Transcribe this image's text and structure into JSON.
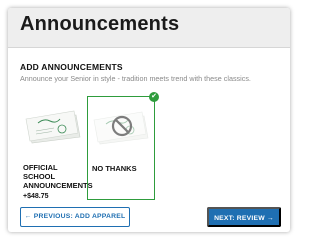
{
  "header": {
    "title": "Announcements"
  },
  "section": {
    "title": "ADD ANNOUNCEMENTS",
    "subtitle": "Announce your Senior in style - tradition meets trend with these classics."
  },
  "options": [
    {
      "label": "OFFICIAL SCHOOL ANNOUNCEMENTS",
      "price": "+$48.75",
      "selected": false,
      "icon": "announcement-card-image"
    },
    {
      "label": "NO THANKS",
      "selected": true,
      "icon": "no-symbol-icon"
    }
  ],
  "selected_badge": {
    "glyph": "✔",
    "icon": "check-icon"
  },
  "navigation": {
    "previous_label": "← PREVIOUS: ADD APPAREL",
    "next_label": "NEXT: REVIEW →"
  },
  "colors": {
    "accent_blue": "#1f6fb2",
    "selected_green": "#2e9c3c",
    "header_bg": "#eeeeee"
  }
}
